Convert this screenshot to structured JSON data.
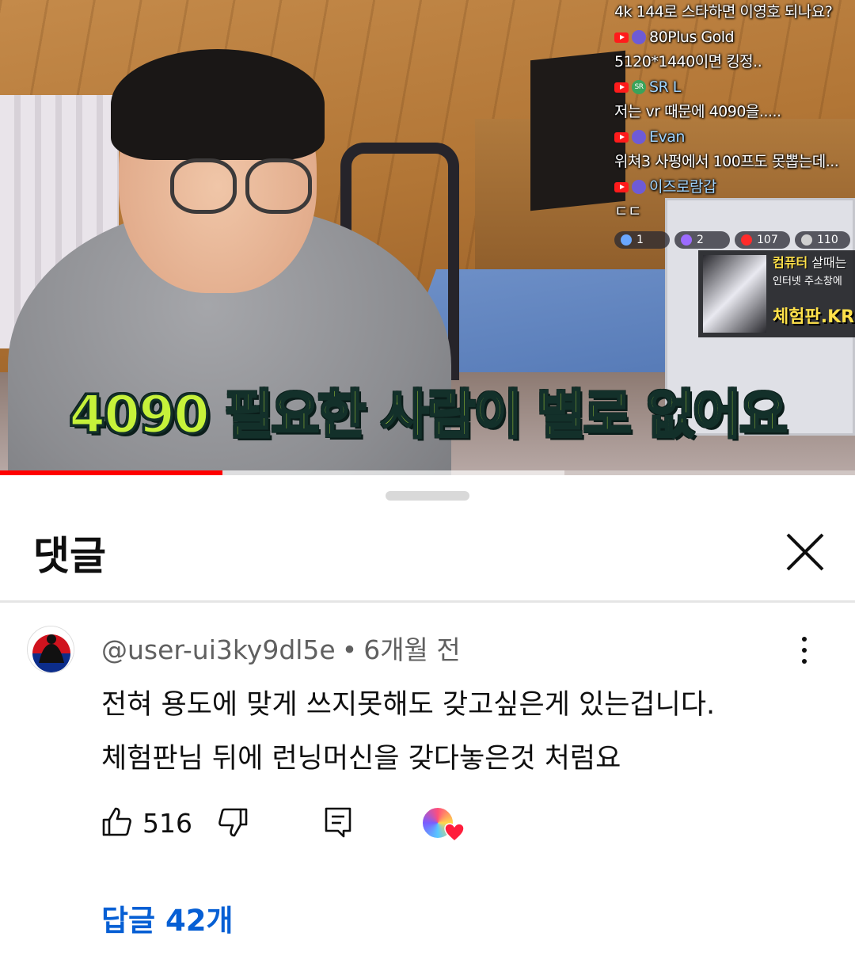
{
  "video": {
    "subtitle": "4090 필요한 사람이 별로 없어요",
    "progress_fraction": 0.26,
    "buffer_fraction": 0.66,
    "chat": [
      {
        "type": "message",
        "text": "4k 144로 스타하면 이영호 되나요?"
      },
      {
        "type": "name",
        "name": "80Plus Gold",
        "color": "#ffffff"
      },
      {
        "type": "message",
        "text": "5120*1440이면 킹정.."
      },
      {
        "type": "name",
        "name": "SR L",
        "color": "#9fd4ff",
        "badge": "SR"
      },
      {
        "type": "message",
        "text": "저는 vr 때문에 4090을....."
      },
      {
        "type": "name",
        "name": "Evan",
        "color": "#9fd4ff"
      },
      {
        "type": "message",
        "text": "위쳐3 사펑에서 100프도 못뽑는데..."
      },
      {
        "type": "name",
        "name": "이즈로람갑",
        "color": "#9fd4ff"
      },
      {
        "type": "message",
        "text": "ㄷㄷ"
      }
    ],
    "stats": [
      {
        "icon": "viewer-icon",
        "value": "1",
        "color": "#6aa7ff"
      },
      {
        "icon": "twitch-icon",
        "value": "2",
        "color": "#9c6bff"
      },
      {
        "icon": "youtube-icon",
        "value": "107",
        "color": "#ff2b2b"
      },
      {
        "icon": "person-icon",
        "value": "110",
        "color": "#d0d0d0"
      }
    ],
    "ad": {
      "line1_highlight": "컴퓨터",
      "line1_rest": " 살때는",
      "line2": "인터넷 주소창에",
      "line3": "체험판.KR"
    }
  },
  "comments": {
    "title": "댓글",
    "comment": {
      "author": "@user-ui3ky9dl5e",
      "separator": "•",
      "time": "6개월 전",
      "text_lines": [
        "전혀 용도에 맞게 쓰지못해도 갖고싶은게 있는겁니다.",
        "체험판님 뒤에 런닝머신을 갖다놓은것 처럼요"
      ],
      "likes": "516",
      "replies_label": "답글 42개"
    }
  },
  "colors": {
    "accent_blue": "#065fd4",
    "progress_red": "#ff0000",
    "subtitle_green": "#c6f23a",
    "heart_red": "#ff1e3c"
  }
}
